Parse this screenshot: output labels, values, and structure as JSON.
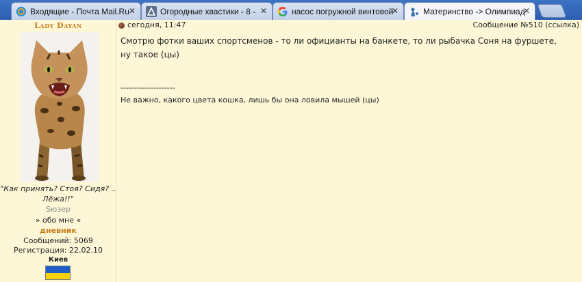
{
  "tabs": [
    {
      "title": "Входящие - Почта Mail.Ru",
      "icon": "mailru-icon",
      "active": false
    },
    {
      "title": "Огородные хвастики - 8 - ",
      "icon": "triangle-site-icon",
      "active": false
    },
    {
      "title": "насос погружной винтовой",
      "icon": "google-icon",
      "active": false
    },
    {
      "title": "Материнство -> Олимпиад",
      "icon": "forum-site-icon",
      "active": true
    }
  ],
  "colors": {
    "page_bg": "#fdf7d8",
    "accent": "#c77b18",
    "tab_strip": "#2b5eb0",
    "flag_blue": "#1e5cc8",
    "flag_yellow": "#f5d20a"
  },
  "author": {
    "name": "Lady Dayan",
    "avatar": "bengal-cat-photo",
    "motto": "\"Как принять? Стоя? Сидя? .. Лёжа!!\"",
    "status": "Sюзер",
    "about_link": "» обо мне «",
    "diary_link": "дневник",
    "posts_count": "Сообщений: 5069",
    "registration": "Регистрация: 22.02.10",
    "city": "Киев",
    "flag": "ukraine-flag"
  },
  "post": {
    "date": "сегодня, 11:47",
    "number": "Сообщение №510",
    "link_label": "(ссылка)",
    "text": "Смотрю фотки ваших спортсменов - то ли официанты на банкете, то ли рыбачка Соня на фуршете, ну такое (цы)",
    "separator": "--------------------",
    "signature": "Не важно, какого цвета кошка, лишь бы она ловила мышей (цы)"
  }
}
